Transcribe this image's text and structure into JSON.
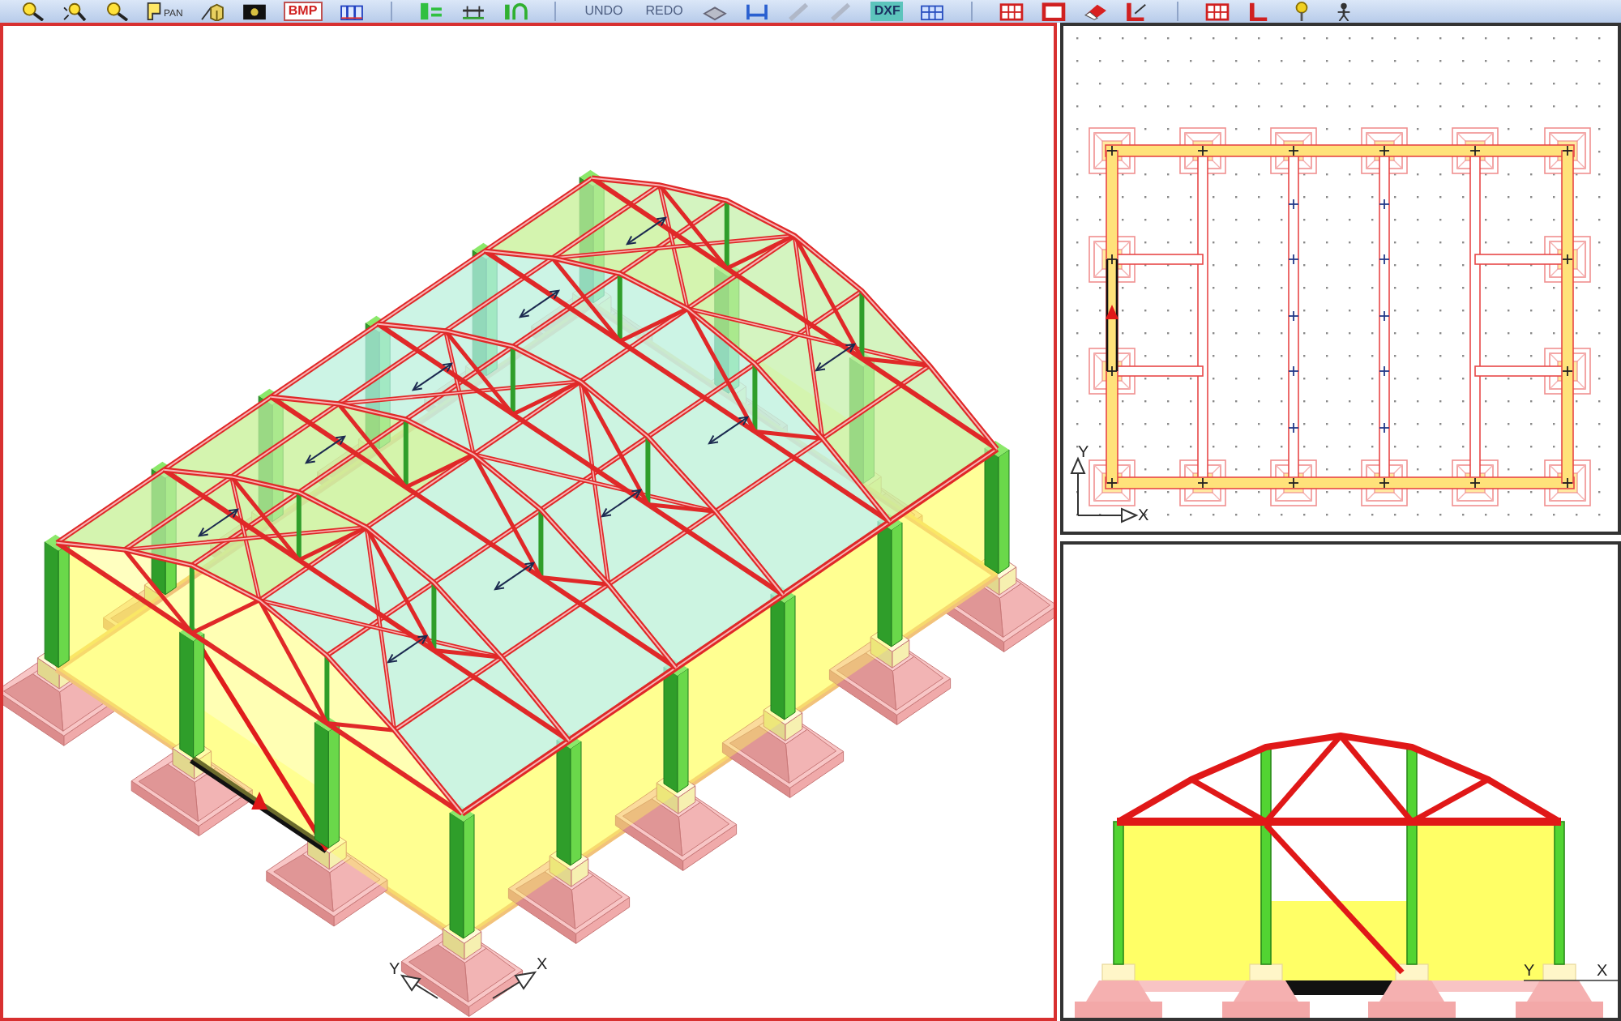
{
  "toolbar": {
    "pan_label": "PAN",
    "bmp_label": "BMP",
    "undo_label": "UNDO",
    "redo_label": "REDO",
    "dxf_label": "DXF"
  },
  "views": [
    {
      "kind": "isometric",
      "selected": true,
      "axis_labels": [
        "Y",
        "X"
      ]
    },
    {
      "kind": "plan",
      "selected": false,
      "axis_labels": [
        "Y",
        "X"
      ]
    },
    {
      "kind": "elevation",
      "selected": false,
      "axis_labels": [
        "Y",
        "X"
      ]
    }
  ]
}
